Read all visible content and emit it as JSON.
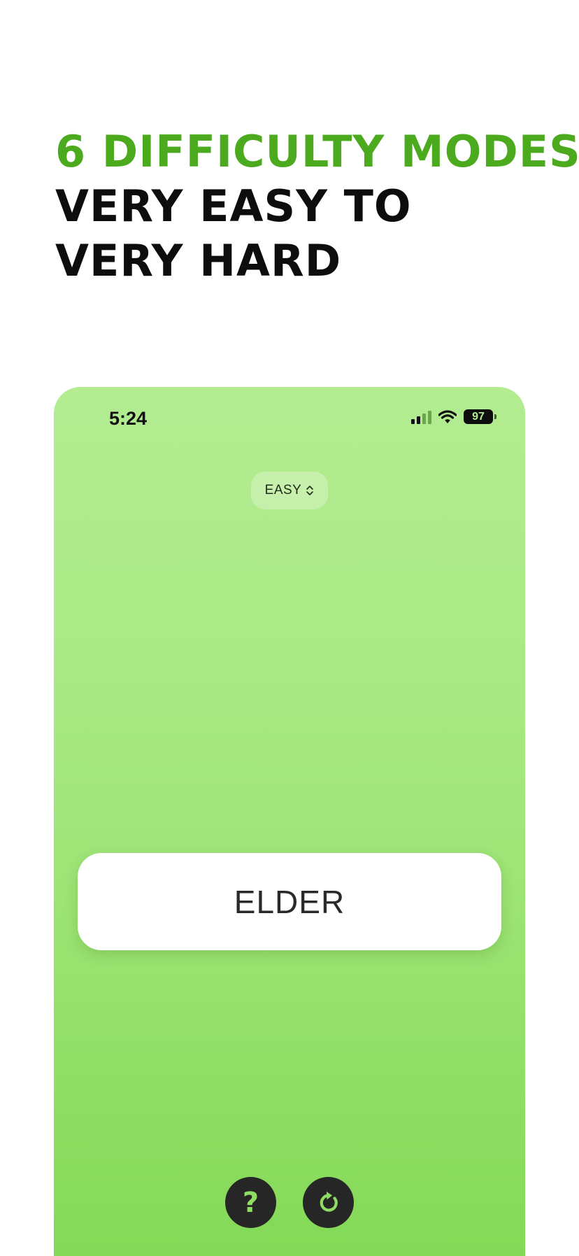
{
  "promo": {
    "line1": "6 DIFFICULTY MODES",
    "line2": "VERY EASY TO",
    "line3": "VERY HARD"
  },
  "status_bar": {
    "time": "5:24",
    "battery": "97",
    "icons": [
      "cellular-signal-icon",
      "wifi-icon",
      "battery-icon"
    ]
  },
  "difficulty": {
    "label": "EASY",
    "icon": "chevron-updown-icon"
  },
  "card": {
    "word": "ELDER"
  },
  "controls": {
    "help_glyph": "?",
    "help_icon": "question-mark-icon",
    "restart_icon": "restart-arrow-icon"
  },
  "colors": {
    "accent_green": "#4caa1f",
    "screen_top": "#b3ec91",
    "screen_bottom": "#84d957",
    "button_bg": "#262626",
    "button_glyph": "#8fdd63"
  }
}
